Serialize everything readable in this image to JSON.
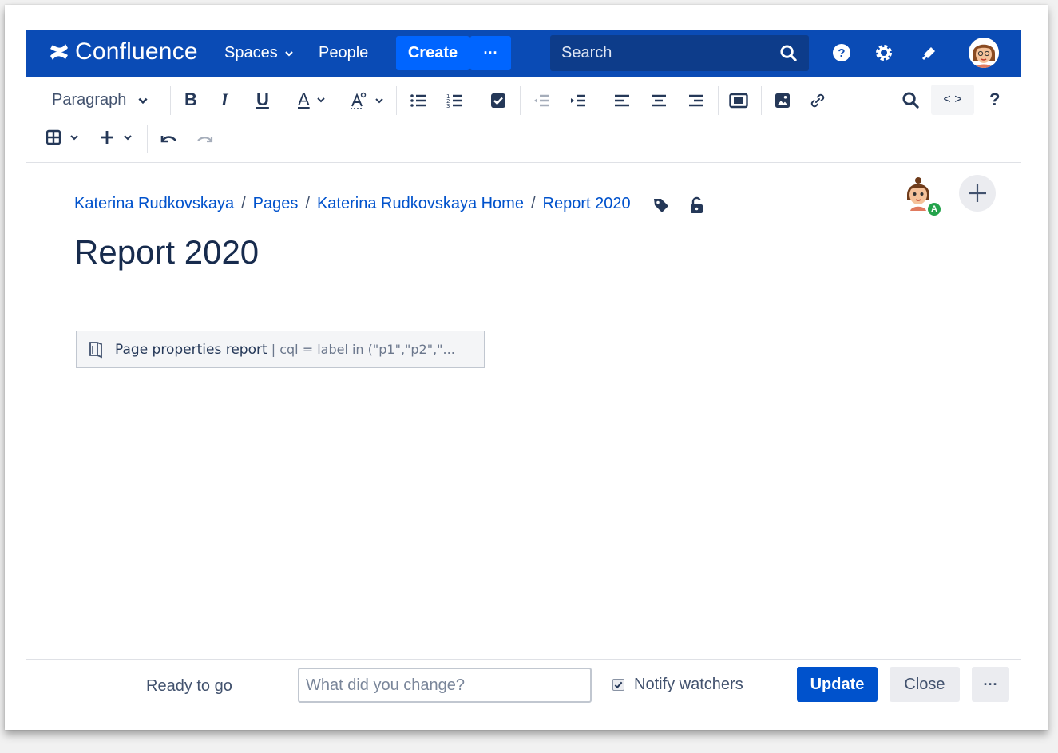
{
  "app": {
    "logo_text": "Confluence",
    "brand_color": "#0a4bb5"
  },
  "nav": {
    "spaces_label": "Spaces",
    "people_label": "People",
    "create_label": "Create",
    "more_label": "···",
    "search_placeholder": "Search",
    "icons": [
      "search-icon",
      "help-icon",
      "settings-icon",
      "notifications-icon",
      "user-avatar"
    ]
  },
  "toolbar": {
    "paragraph_label": "Paragraph",
    "bold_label": "B",
    "italic_label": "I",
    "underline_label": "U",
    "text_color_label": "A",
    "source_label": "< >",
    "help_label": "?"
  },
  "page": {
    "breadcrumb": [
      "Katerina Rudkovskaya",
      "Pages",
      "Katerina Rudkovskaya Home",
      "Report 2020"
    ],
    "breadcrumb_separator": "/",
    "title": "Report 2020",
    "collaborator_badge": "A",
    "macro": {
      "name": "Page properties report",
      "params": "| cql = label in (\"p1\",\"p2\",\"..."
    }
  },
  "footer": {
    "status": "Ready to go",
    "change_placeholder": "What did you change?",
    "notify_label": "Notify watchers",
    "notify_checked": true,
    "update_label": "Update",
    "close_label": "Close",
    "more_label": "···"
  }
}
